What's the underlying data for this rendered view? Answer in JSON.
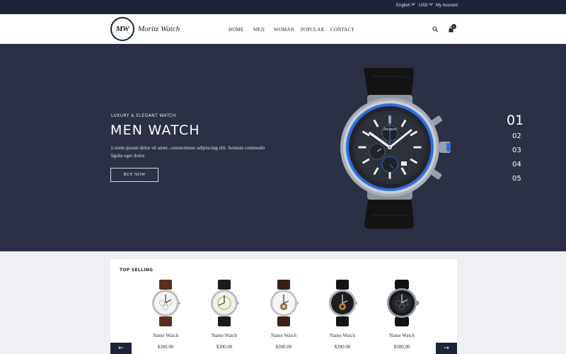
{
  "topbar": {
    "language": "English",
    "currency": "USD",
    "account": "My Account"
  },
  "header": {
    "logo_mark": "MW",
    "brand": "Moritz Watch",
    "nav": [
      "HOME",
      "MEN",
      "WOMAN",
      "POPULAR",
      "CONTACT"
    ],
    "cart_count": "1"
  },
  "hero": {
    "kicker": "LUXURY & ELEGANT WATCH",
    "title": "MEN WATCH",
    "description": "Lorem ipsum dolor sit amet, consectetuer adipiscing elit. Aenean commodo ligula eget dolor.",
    "button": "BUY NOW",
    "slides": [
      "01",
      "02",
      "03",
      "04",
      "05"
    ],
    "active_slide": "01",
    "watch_brand": "Jacques"
  },
  "top_selling": {
    "title": "TOP SELLING",
    "products": [
      {
        "name": "Name Watch",
        "price": "$300.00"
      },
      {
        "name": "Name Watch",
        "price": "$300.00"
      },
      {
        "name": "Name Watch",
        "price": "$300.00"
      },
      {
        "name": "Name Watch",
        "price": "$300.00"
      },
      {
        "name": "Name Watch",
        "price": "$300.00"
      }
    ],
    "prev_arrow": "←",
    "next_arrow": "→"
  },
  "icons": {
    "search": "search-icon",
    "cart": "cart-icon",
    "prev": "arrow-left-icon",
    "next": "arrow-right-icon"
  },
  "colors": {
    "topbar": "#1e2438",
    "hero_bg": "#2b3044",
    "accent_blue": "#2f6ee0",
    "page_bg": "#eef0f4"
  }
}
